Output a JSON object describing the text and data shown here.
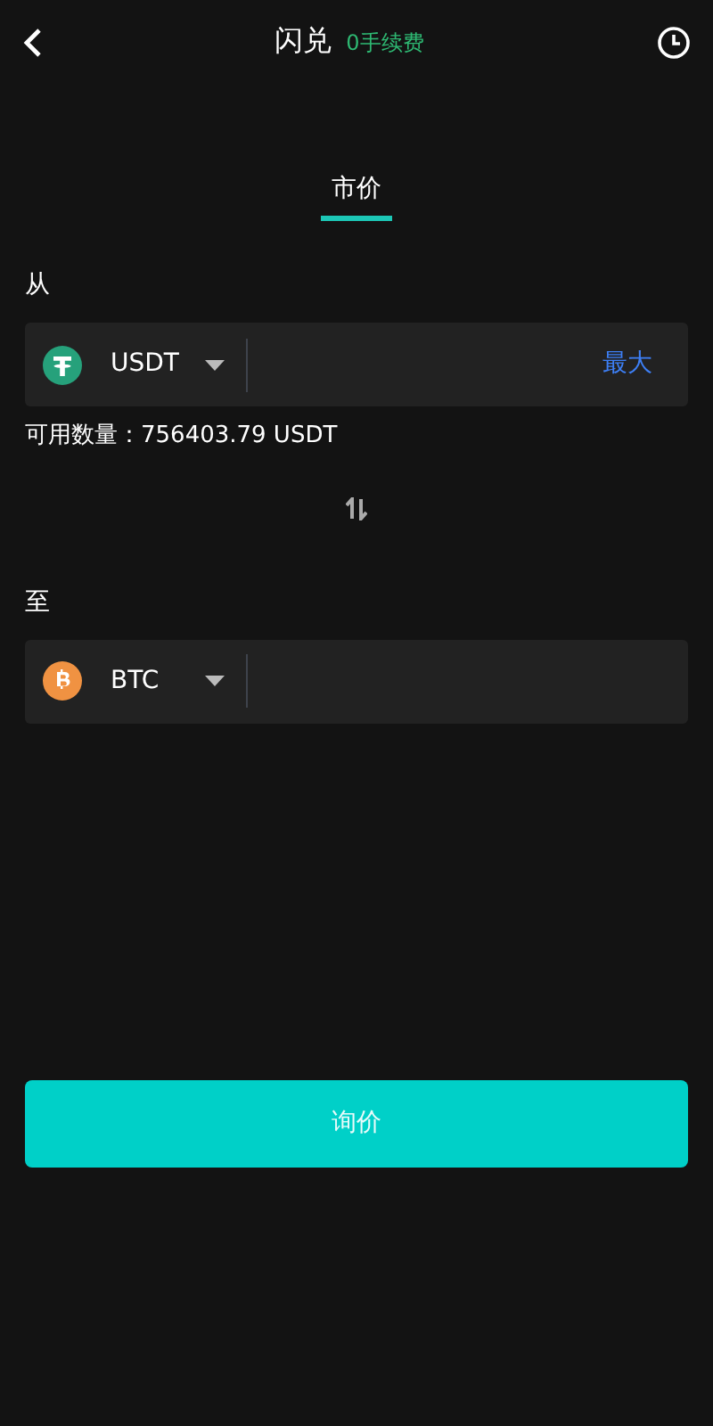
{
  "header": {
    "title": "闪兑",
    "subtitle": "0手续费"
  },
  "tabs": [
    {
      "label": "市价",
      "selected": true
    }
  ],
  "from": {
    "label": "从",
    "coin": {
      "kind": "usdt",
      "symbol": "USDT"
    },
    "action": "最大"
  },
  "available": "可用数量：756403.79 USDT",
  "to": {
    "label": "至",
    "coin": {
      "kind": "btc",
      "symbol": "BTC"
    }
  },
  "submit": "询价"
}
